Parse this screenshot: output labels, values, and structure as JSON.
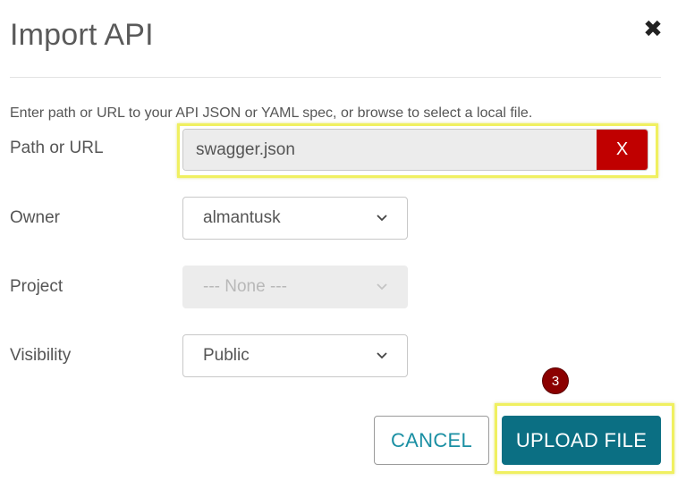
{
  "dialog": {
    "title": "Import API",
    "close_icon": "close-icon"
  },
  "form": {
    "instructions": "Enter path or URL to your API JSON or YAML spec, or browse to select a local file.",
    "path": {
      "label": "Path or URL",
      "value": "swagger.json",
      "clear_label": "X"
    },
    "owner": {
      "label": "Owner",
      "value": "almantusk"
    },
    "project": {
      "label": "Project",
      "value": "--- None ---",
      "disabled": true
    },
    "visibility": {
      "label": "Visibility",
      "value": "Public"
    }
  },
  "footer": {
    "step_number": "3",
    "cancel_label": "CANCEL",
    "upload_label": "UPLOAD FILE"
  },
  "colors": {
    "highlight": "#f0f060",
    "clear_button": "#c00000",
    "primary_button": "#0b6f83",
    "cancel_text": "#1a8fa3",
    "step_badge": "#8b0000"
  }
}
